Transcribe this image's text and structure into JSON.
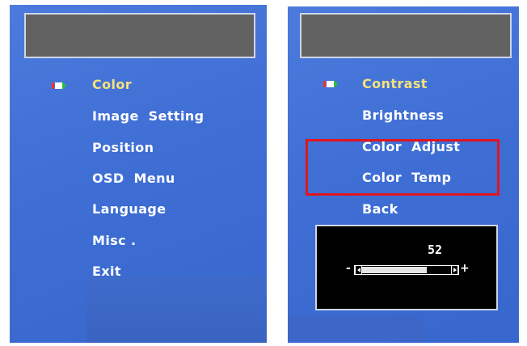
{
  "left_menu": {
    "selected_index": 0,
    "items": [
      {
        "label": "Color"
      },
      {
        "label": "Image  Setting"
      },
      {
        "label": "Position"
      },
      {
        "label": "OSD  Menu"
      },
      {
        "label": "Language"
      },
      {
        "label": "Misc ."
      },
      {
        "label": "Exit"
      }
    ]
  },
  "right_menu": {
    "selected_index": 0,
    "items": [
      {
        "label": "Contrast"
      },
      {
        "label": "Brightness"
      },
      {
        "label": "Color  Adjust"
      },
      {
        "label": "Color  Temp"
      },
      {
        "label": "Back"
      }
    ],
    "highlighted": [
      "Color  Adjust",
      "Color  Temp"
    ]
  },
  "slider": {
    "value": "52",
    "level": 0.52,
    "minus": "-",
    "plus": "+"
  },
  "colors": {
    "panel_bg": "#4172d6",
    "header_box": "#626262",
    "selected_text": "#f5e27a",
    "highlight_border": "#e1151f",
    "arrow_icon": "#2fbf3a"
  }
}
